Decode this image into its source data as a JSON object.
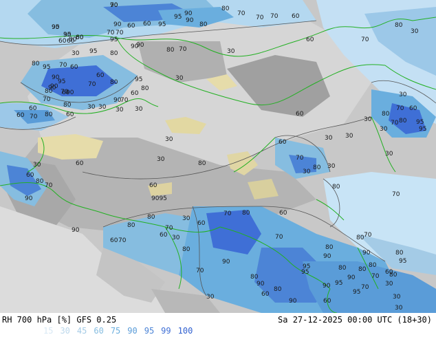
{
  "header": {
    "product": "RH 700 hPa [%] GFS 0.25",
    "valid_time": "Sa 27-12-2025 00:00 UTC (18+30)"
  },
  "legend": {
    "levels": [
      {
        "label": "15",
        "color": "#d8e8f4"
      },
      {
        "label": "30",
        "color": "#bcd8ec"
      },
      {
        "label": "45",
        "color": "#a4cbe6"
      },
      {
        "label": "60",
        "color": "#86bde0"
      },
      {
        "label": "75",
        "color": "#6aaede"
      },
      {
        "label": "90",
        "color": "#5a9cd8"
      },
      {
        "label": "95",
        "color": "#4c84d6"
      },
      {
        "label": "99",
        "color": "#3f6fd6"
      },
      {
        "label": "100",
        "color": "#3060d0"
      }
    ]
  },
  "map": {
    "colors": {
      "dry_gray": "#c8c8c8",
      "light_gray": "#dcdcdc",
      "mid_gray": "#a8a8a8",
      "dark_gray": "#909090",
      "desert_tan": "#e6dcaa",
      "light_blue": "#b4d8f0",
      "mid_blue": "#6aaede",
      "deep_blue": "#3f6fd6",
      "border_green": "#22b022",
      "contour_line": "#555555"
    },
    "contour_labels": [
      "90",
      "90",
      "95",
      "80",
      "90",
      "70",
      "60",
      "95",
      "90",
      "80",
      "95",
      "90",
      "80",
      "70",
      "70",
      "70",
      "60",
      "60",
      "70",
      "60",
      "80",
      "90",
      "95",
      "90",
      "80",
      "70",
      "60",
      "30",
      "95",
      "80",
      "60",
      "30",
      "80",
      "95",
      "60",
      "60",
      "70",
      "90",
      "70",
      "80",
      "95",
      "60",
      "80",
      "90",
      "90",
      "70",
      "95",
      "90",
      "30",
      "80",
      "90",
      "60",
      "70",
      "80",
      "60",
      "70",
      "30",
      "30",
      "30",
      "60",
      "70",
      "80",
      "60",
      "30",
      "60",
      "70",
      "30",
      "30",
      "80",
      "95",
      "30",
      "70",
      "80",
      "30",
      "80",
      "95",
      "60",
      "70",
      "30",
      "60",
      "30",
      "30",
      "30",
      "30",
      "60",
      "80",
      "70",
      "80",
      "30",
      "30",
      "60",
      "60",
      "80",
      "70",
      "9095",
      "70",
      "80",
      "30",
      "60",
      "80",
      "70",
      "90",
      "80",
      "90",
      "60",
      "70",
      "30",
      "60",
      "70",
      "80",
      "60",
      "30",
      "80",
      "70",
      "90",
      "80",
      "70",
      "80",
      "95",
      "90",
      "80",
      "95",
      "90",
      "95",
      "90",
      "60",
      "80",
      "70",
      "80",
      "90",
      "80",
      "90",
      "95",
      "95",
      "30",
      "30",
      "30",
      "70",
      "80",
      "60",
      "90",
      "60",
      "80",
      "70",
      "30",
      "80",
      "70",
      "95",
      "30",
      "60"
    ]
  }
}
